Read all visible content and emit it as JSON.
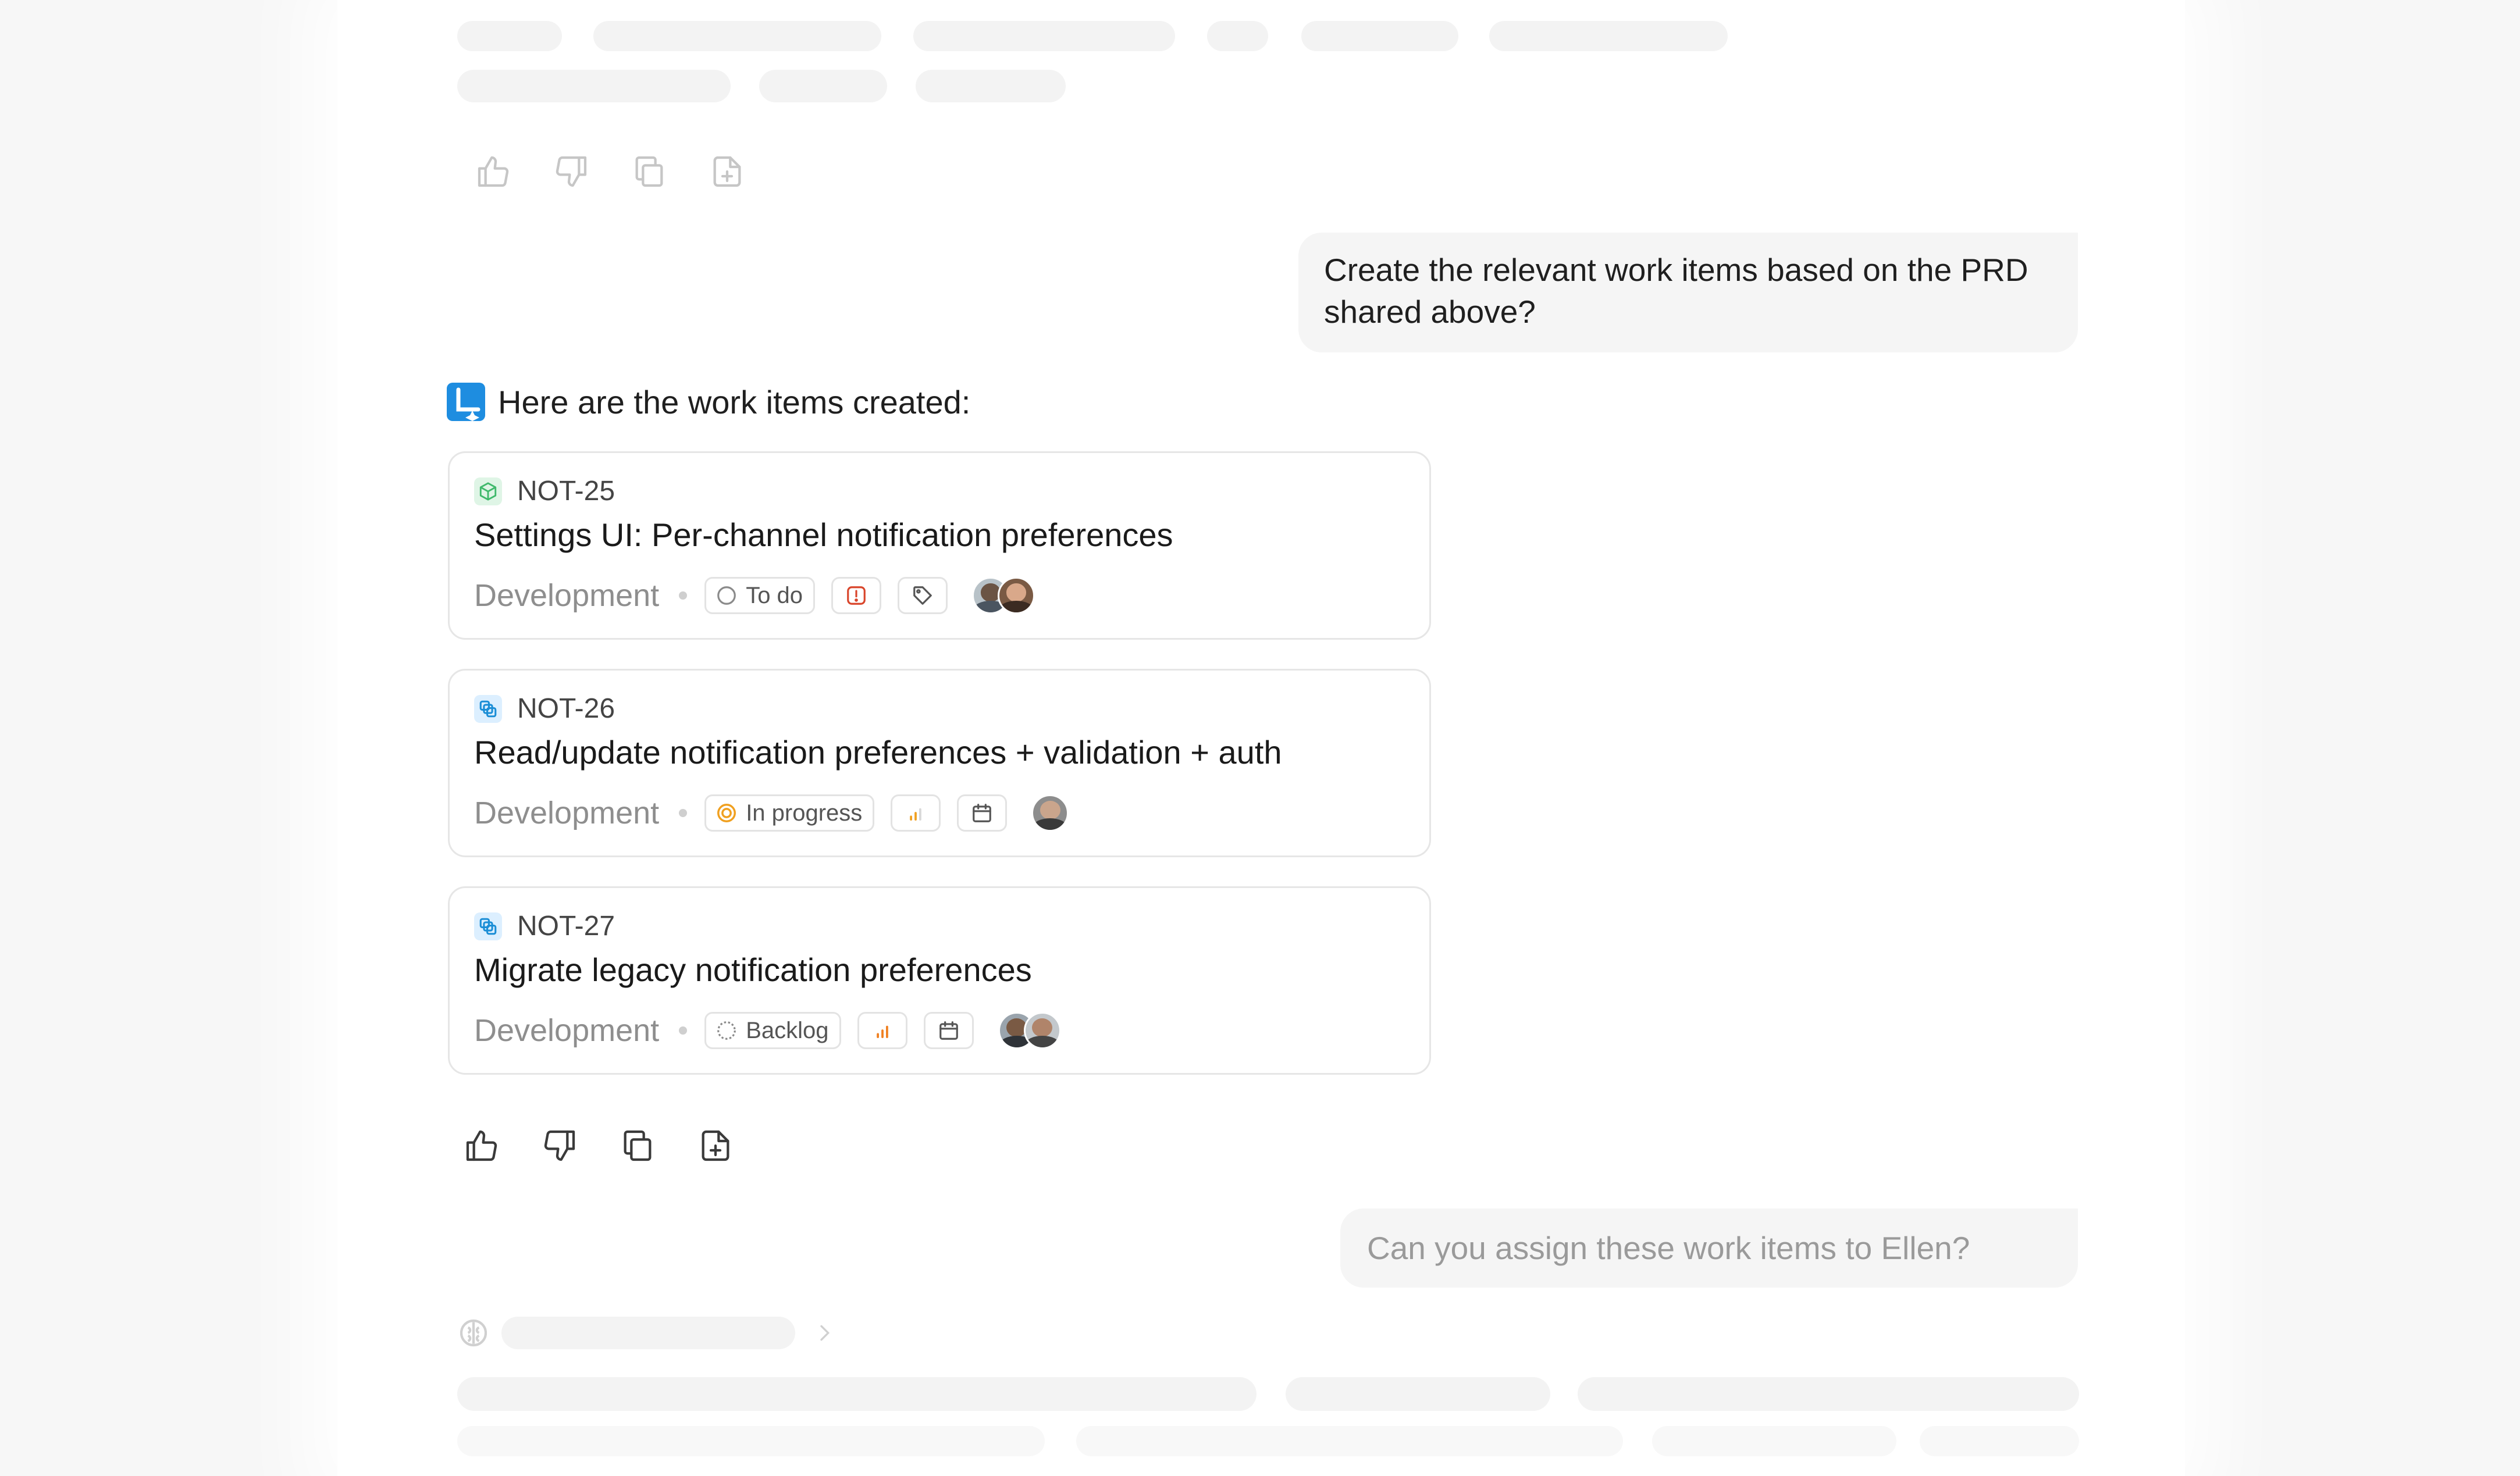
{
  "conversation": {
    "user_message_1": "Create the relevant work items based on the PRD shared above?",
    "assistant_intro": "Here are the work items created:",
    "user_message_2": "Can you assign these work items to Ellen?"
  },
  "work_items": [
    {
      "id": "NOT-25",
      "type_icon": "package-icon",
      "type_color": "#3fb96b",
      "title": "Settings UI: Per-channel notification preferences",
      "project": "Development",
      "state": "To do",
      "state_icon": "circle-outline-icon",
      "priority_icon": "urgent-priority-icon",
      "label_icon": "tag-icon",
      "assignee_count": 2
    },
    {
      "id": "NOT-26",
      "type_icon": "layers-icon",
      "type_color": "#1b8ed6",
      "title": "Read/update notification preferences + validation + auth",
      "project": "Development",
      "state": "In progress",
      "state_icon": "in-progress-icon",
      "priority_icon": "medium-priority-icon",
      "date_icon": "calendar-icon",
      "assignee_count": 1
    },
    {
      "id": "NOT-27",
      "type_icon": "layers-icon",
      "type_color": "#1b8ed6",
      "title": "Migrate legacy notification preferences",
      "project": "Development",
      "state": "Backlog",
      "state_icon": "dashed-circle-icon",
      "priority_icon": "high-priority-icon",
      "date_icon": "calendar-icon",
      "assignee_count": 2
    }
  ],
  "colors": {
    "accent": "#1e8de0",
    "urgent": "#d9452b",
    "priority_bars": "#f0a020",
    "in_progress": "#f0a020"
  }
}
